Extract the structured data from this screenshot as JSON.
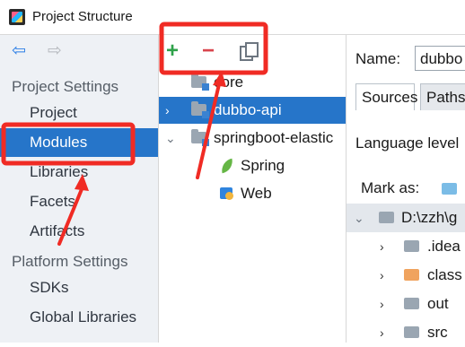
{
  "window": {
    "title": "Project Structure",
    "icon": "intellij-app-icon"
  },
  "left_panel": {
    "back_icon": "back-arrow-icon",
    "forward_icon": "forward-arrow-icon",
    "project_settings_label": "Project Settings",
    "project_settings_items": [
      "Project",
      "Modules",
      "Libraries",
      "Facets",
      "Artifacts"
    ],
    "platform_settings_label": "Platform Settings",
    "platform_settings_items": [
      "SDKs",
      "Global Libraries"
    ],
    "selected_item": "Modules"
  },
  "toolbar": {
    "add_symbol": "+",
    "remove_symbol": "−",
    "copy_icon": "copy-icon"
  },
  "module_tree": {
    "rows": [
      {
        "label": "core",
        "chevron": ""
      },
      {
        "label": "dubbo-api",
        "chevron": "›"
      },
      {
        "label": "springboot-elastic",
        "chevron": "⌄"
      },
      {
        "label": "Spring",
        "chevron": ""
      },
      {
        "label": "Web",
        "chevron": ""
      }
    ],
    "selected": "dubbo-api"
  },
  "details": {
    "name_label": "Name:",
    "name_value": "dubbo",
    "tabs": [
      "Sources",
      "Paths"
    ],
    "active_tab": "Sources",
    "language_level_label": "Language level",
    "mark_as_label": "Mark as:",
    "content_root": "D:\\zzh\\g",
    "content_children": [
      {
        "label": ".idea",
        "chevron": "›",
        "color": "#9aa6b2"
      },
      {
        "label": "class",
        "chevron": "›",
        "color": "#f0a35e"
      },
      {
        "label": "out",
        "chevron": "›",
        "color": "#9aa6b2"
      },
      {
        "label": "src",
        "chevron": "›",
        "color": "#9aa6b2"
      }
    ]
  },
  "annotations": {
    "highlight_color": "#f02b24"
  }
}
